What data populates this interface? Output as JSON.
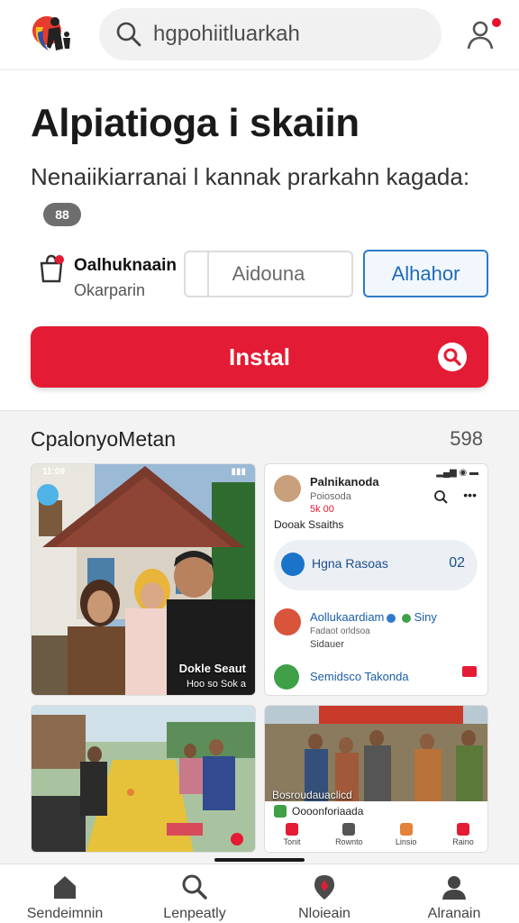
{
  "header": {
    "search_placeholder": "hgpohiitluarkah"
  },
  "app": {
    "title": "Alpiatioga i skaiin",
    "description": "Nenaiikiarranai l kannak  prarkahn kagada:",
    "description_badge": "88",
    "developer_name": "Oalhuknaain",
    "developer_sub": "Okarparin",
    "secondary_button": "Aidouna",
    "tertiary_button": "Alhahor",
    "install_label": "Instal"
  },
  "gallery": {
    "title": "CpalonyoMetan",
    "count": "598",
    "tile1": {
      "time": "11:09",
      "caption": "Dokle Seaut",
      "sub": "Hoo so Sok a"
    },
    "tile2": {
      "name": "Palnikanoda",
      "sub": "Poiosoda",
      "likes": "5k 00",
      "row": "Dooak  Ssaiths",
      "pill_text": "Hgna Rasoas",
      "pill_num": "02",
      "row2_name": "Aollukaardiam",
      "row2_badge": "Siny",
      "row2_sub": "Fadaot orldsoa",
      "row2_meta": "Sidauer",
      "row3": "Semidsco Takonda"
    },
    "tile4": {
      "caption": "Bosroudauaclicd",
      "card_title": "Oooonforiaada",
      "icons": [
        "Tonit",
        "Rownto",
        "Linsio",
        "Raino"
      ]
    }
  },
  "nav": {
    "items": [
      "Sendeimnin",
      "Lenpeatly",
      "Nloieain",
      "Alranain"
    ]
  },
  "colors": {
    "accent": "#e41b34",
    "link_blue": "#2e7bc9"
  }
}
